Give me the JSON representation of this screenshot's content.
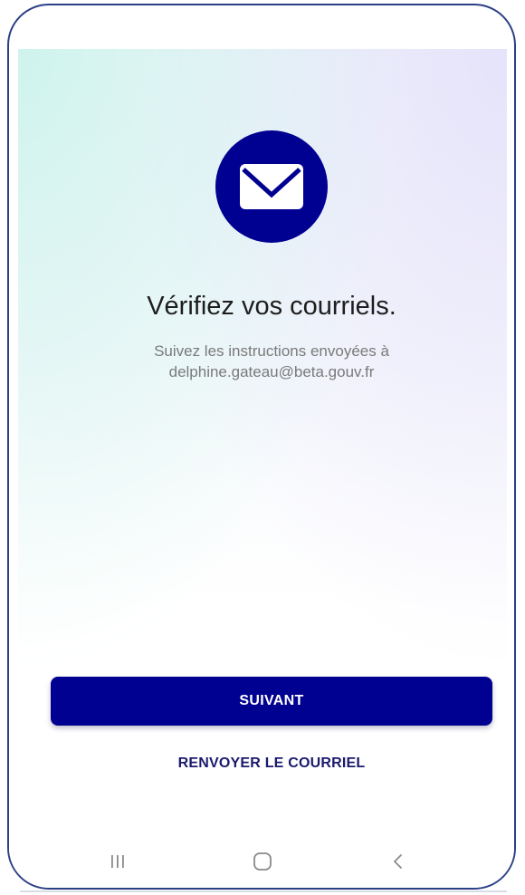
{
  "screen": {
    "title": "Vérifiez vos courriels.",
    "instructions_line1": "Suivez les instructions envoyées à",
    "email": "delphine.gateau@beta.gouv.fr"
  },
  "actions": {
    "next_label": "SUIVANT",
    "resend_label": "RENVOYER LE COURRIEL"
  },
  "icons": {
    "mail": "envelope-icon",
    "recents": "recent-apps-icon",
    "home": "home-icon",
    "back": "back-icon"
  },
  "colors": {
    "primary": "#000091",
    "frame": "#2b3f86",
    "title_text": "#1e1e1e",
    "muted_text": "#7a7a7a",
    "resend_text": "#1a1a6e"
  }
}
